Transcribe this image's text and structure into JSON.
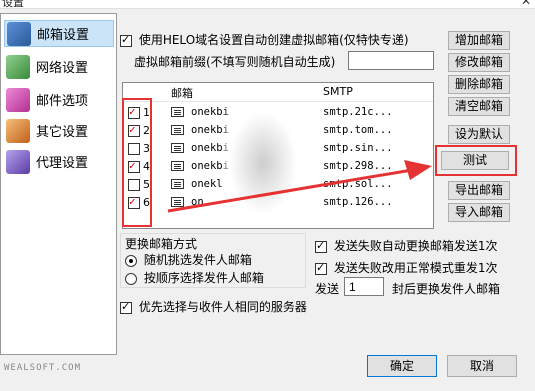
{
  "window": {
    "title": "设置",
    "close_icon": "close-icon"
  },
  "sidebar": {
    "items": [
      {
        "label": "邮箱设置",
        "icon": "mailbox-icon",
        "color": "#3a6fb0",
        "active": true
      },
      {
        "label": "网络设置",
        "icon": "network-icon",
        "color": "#4a9a4a",
        "active": false
      },
      {
        "label": "邮件选项",
        "icon": "mail-options-icon",
        "color": "#c23fa8",
        "active": false
      },
      {
        "label": "其它设置",
        "icon": "other-settings-icon",
        "color": "#d0812a",
        "active": false
      },
      {
        "label": "代理设置",
        "icon": "proxy-icon",
        "color": "#7a5cc0",
        "active": false
      }
    ]
  },
  "main": {
    "use_helo_label": "使用HELO域名设置自动创建虚拟邮箱(仅特快专递)",
    "use_helo_checked": true,
    "prefix_label": "虚拟邮箱前缀(不填写则随机自动生成)",
    "prefix_value": "",
    "list": {
      "headers": {
        "mailbox": "邮箱",
        "smtp": "SMTP"
      },
      "rows": [
        {
          "num": "1",
          "checked": true,
          "mail": "onekbi",
          "smtp": "smtp.21c..."
        },
        {
          "num": "2",
          "checked": true,
          "mail": "onekbi",
          "smtp": "smtp.tom..."
        },
        {
          "num": "3",
          "checked": false,
          "mail": "onekbi",
          "smtp": "smtp.sin..."
        },
        {
          "num": "4",
          "checked": true,
          "mail": "onekbi",
          "smtp": "smtp.298..."
        },
        {
          "num": "5",
          "checked": false,
          "mail": "onekl",
          "smtp": "smtp.sol..."
        },
        {
          "num": "6",
          "checked": true,
          "mail": "on",
          "smtp": "smtp.126..."
        }
      ]
    },
    "switch_group": {
      "title": "更换邮箱方式",
      "options": [
        {
          "label": "随机挑选发件人邮箱",
          "selected": true
        },
        {
          "label": "按顺序选择发件人邮箱",
          "selected": false
        }
      ]
    },
    "prefer_same_server_label": "优先选择与收件人相同的服务器",
    "prefer_same_server_checked": true,
    "auto_switch_label": "发送失败自动更换邮箱发送1次",
    "auto_switch_checked": true,
    "retry_normal_label": "发送失败改用正常模式重发1次",
    "retry_normal_checked": true,
    "send_label": "发送",
    "send_count": "1",
    "after_label": "封后更换发件人邮箱"
  },
  "buttons": {
    "add": "增加邮箱",
    "edit": "修改邮箱",
    "delete": "删除邮箱",
    "clear": "清空邮箱",
    "set_default": "设为默认",
    "test": "测试",
    "export": "导出邮箱",
    "import": "导入邮箱",
    "ok": "确定",
    "cancel": "取消"
  },
  "footer": {
    "watermark": "WEALSOFT.COM"
  },
  "colors": {
    "highlight": "#e53333",
    "active_bg": "#cce4f7",
    "focus": "#0078d7"
  }
}
